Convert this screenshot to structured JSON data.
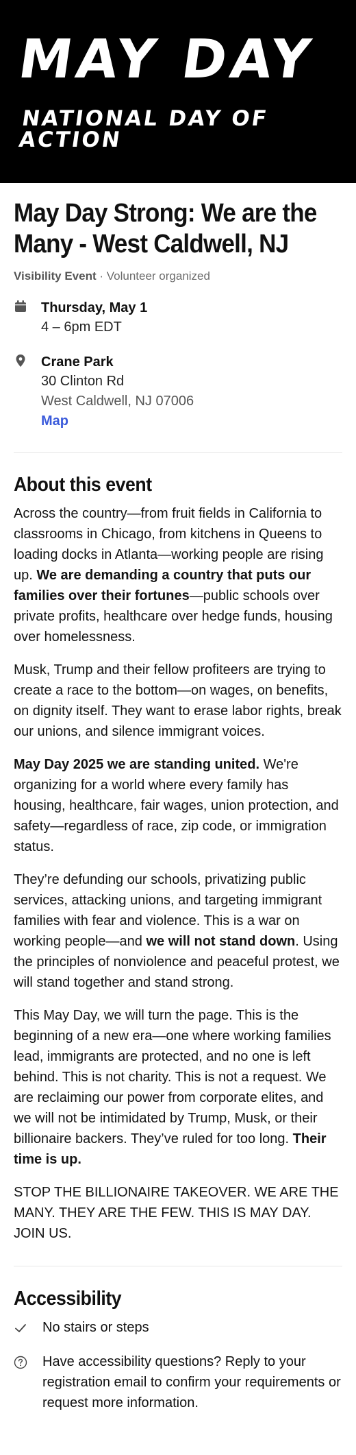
{
  "hero": {
    "title": "MAY DAY",
    "subtitle": "NATIONAL DAY OF ACTION"
  },
  "event": {
    "title": "May Day Strong: We are the Many - West Caldwell, NJ",
    "type": "Visibility Event",
    "separator": " · ",
    "organizer": "Volunteer organized",
    "date": "Thursday, May 1",
    "time": "4 – 6pm EDT",
    "location_name": "Crane Park",
    "address_line1": "30 Clinton Rd",
    "address_line2": "West Caldwell, NJ 07006",
    "map_label": "Map"
  },
  "about": {
    "heading": "About this event",
    "p1_a": "Across the country—from fruit fields in California to classrooms in Chicago, from kitchens in Queens to loading docks in Atlanta—working people are rising up. ",
    "p1_bold": "We are demanding a country that puts our families over their fortunes",
    "p1_b": "—public schools over private profits, healthcare over hedge funds, housing over homelessness.",
    "p2": "Musk, Trump and their fellow profiteers are trying to create a race to the bottom—on wages, on benefits, on dignity itself. They want to erase labor rights, break our unions, and silence immigrant voices.",
    "p3_bold": "May Day 2025 we are standing united.",
    "p3_rest": " We're organizing for a world where every family has housing, healthcare, fair wages, union protection, and safety—regardless of race, zip code, or immigration status.",
    "p4_a": "They’re defunding our schools, privatizing public services, attacking unions, and targeting immigrant families with fear and violence. This is a war on working people—and ",
    "p4_bold": "we will not stand down",
    "p4_b": ". Using the principles of nonviolence and peaceful protest, we will stand together and stand strong.",
    "p5_a": "This May Day, we will turn the page. This is the beginning of a new era—one where working families lead, immigrants are protected, and no one is left behind. This is not charity. This is not a request. We are reclaiming our power from corporate elites, and we will not be intimidated by Trump, Musk, or their billionaire backers. They’ve ruled for too long. ",
    "p5_bold": "Their time is up.",
    "p6": "STOP THE BILLIONAIRE TAKEOVER. WE ARE THE MANY. THEY ARE THE FEW. THIS IS MAY DAY. JOIN US."
  },
  "accessibility": {
    "heading": "Accessibility",
    "item1": "No stairs or steps",
    "item2": "Have accessibility questions? Reply to your registration email to confirm your requirements or request more information."
  },
  "icons": {
    "calendar": "calendar-icon",
    "location": "map-pin-icon",
    "check": "check-icon",
    "help": "question-circle-icon"
  },
  "colors": {
    "hero_bg": "#000000",
    "link": "#3b5bdb",
    "muted": "#6b6b6b"
  }
}
